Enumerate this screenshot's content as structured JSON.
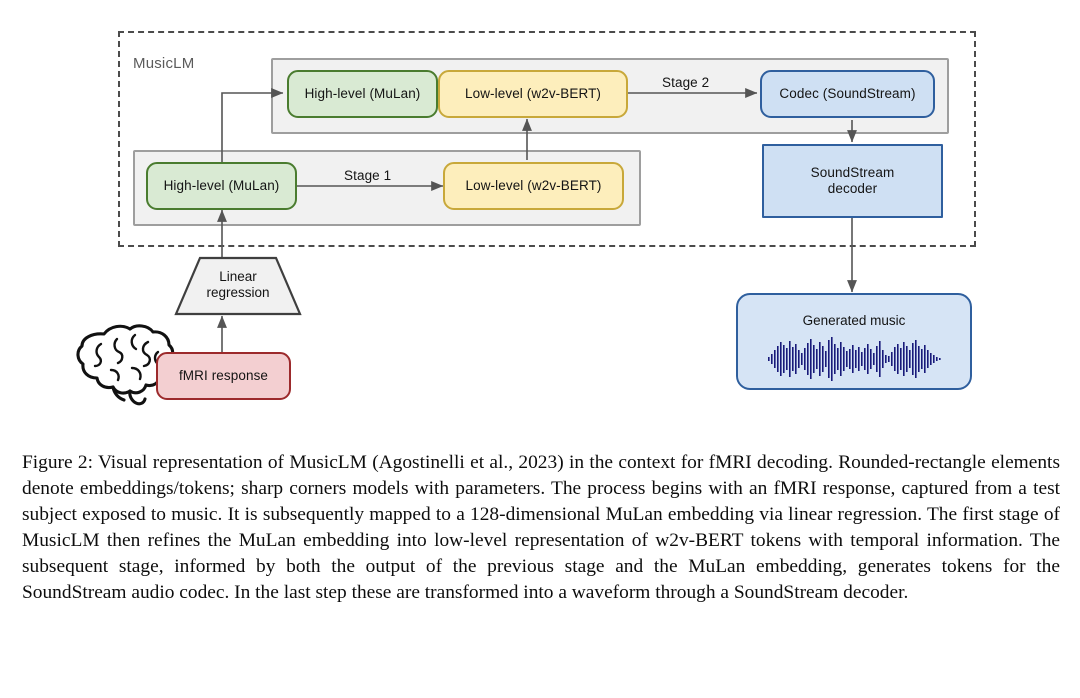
{
  "figure": {
    "container_label": "MusicLM",
    "nodes": {
      "top_high_level": "High-level (MuLan)",
      "top_low_level": "Low-level (w2v-BERT)",
      "codec": "Codec (SoundStream)",
      "bottom_high_level": "High-level (MuLan)",
      "bottom_low_level": "Low-level (w2v-BERT)",
      "soundstream_decoder": "SoundStream\ndecoder",
      "linear_regression": "Linear\nregression",
      "fmri_response": "fMRI response",
      "generated_music": "Generated music"
    },
    "edge_labels": {
      "stage1": "Stage 1",
      "stage2": "Stage 2"
    },
    "icons": {
      "brain": "brain-icon",
      "waveform": "audio-waveform-icon"
    },
    "colors": {
      "green_fill": "#d9ead3",
      "green_border": "#4a7c2f",
      "yellow_fill": "#fdeebc",
      "yellow_border": "#c8a83a",
      "blue_fill": "#cfe0f3",
      "blue_border": "#2f5f9e",
      "red_fill": "#f3cfd1",
      "red_border": "#9c2a2c",
      "band_fill": "#f1f1f1",
      "band_border": "#9e9e9e",
      "dashed_border": "#4b4b4b",
      "waveform": "#181a7a"
    }
  },
  "caption": {
    "label": "Figure 2:",
    "text": "  Visual representation of MusicLM (Agostinelli et al., 2023) in the context for fMRI decoding.  Rounded-rectangle elements denote embeddings/tokens; sharp corners models with parameters. The process begins with an fMRI response, captured from a test subject exposed to music. It is subsequently mapped to a 128-dimensional MuLan embedding via linear regression. The first stage of MusicLM then refines the MuLan embedding into low-level representation of w2v-BERT tokens with temporal information. The subsequent stage, informed by both the output of the previous stage and the MuLan embedding, generates tokens for the SoundStream audio codec. In the last step these are transformed into a waveform through a SoundStream decoder."
  }
}
